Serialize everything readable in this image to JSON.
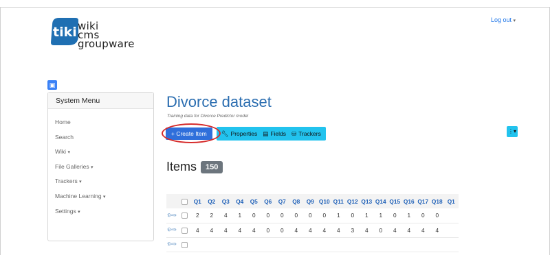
{
  "header": {
    "logo_line1": "wiki",
    "logo_line2": "cms",
    "logo_line3": "groupware",
    "logo_mark": "tiki",
    "logout_label": "Log out"
  },
  "sidebar": {
    "title": "System Menu",
    "items": [
      {
        "label": "Home",
        "caret": false
      },
      {
        "label": "Search",
        "caret": false
      },
      {
        "label": "Wiki",
        "caret": true
      },
      {
        "label": "File Galleries",
        "caret": true
      },
      {
        "label": "Trackers",
        "caret": true
      },
      {
        "label": "Machine Learning",
        "caret": true
      },
      {
        "label": "Settings",
        "caret": true
      }
    ]
  },
  "main": {
    "title": "Divorce dataset",
    "subtitle": "Training data for Divorce Predictor model",
    "toolbar": {
      "create_label": "+ Create Item",
      "properties_label": "Properties",
      "fields_label": "Fields",
      "trackers_label": "Trackers"
    },
    "items_heading": "Items",
    "items_count": "150"
  },
  "table": {
    "columns": [
      "Q1",
      "Q2",
      "Q3",
      "Q4",
      "Q5",
      "Q6",
      "Q7",
      "Q8",
      "Q9",
      "Q10",
      "Q11",
      "Q12",
      "Q13",
      "Q14",
      "Q15",
      "Q16",
      "Q17",
      "Q18",
      "Q1"
    ],
    "rows": [
      [
        "2",
        "2",
        "4",
        "1",
        "0",
        "0",
        "0",
        "0",
        "0",
        "0",
        "1",
        "0",
        "1",
        "1",
        "0",
        "1",
        "0",
        "0",
        ""
      ],
      [
        "4",
        "4",
        "4",
        "4",
        "4",
        "0",
        "0",
        "4",
        "4",
        "4",
        "4",
        "3",
        "4",
        "0",
        "4",
        "4",
        "4",
        "4",
        ""
      ],
      [
        "",
        "",
        "",
        "",
        "",
        "",
        "",
        "",
        "",
        "",
        "",
        "",
        "",
        "",
        "",
        "",
        "",
        "",
        ""
      ]
    ]
  },
  "colors": {
    "accent": "#2f6fdb",
    "info": "#22c3ee",
    "title_blue": "#2a6db0",
    "highlight_red": "#d62b2b"
  }
}
